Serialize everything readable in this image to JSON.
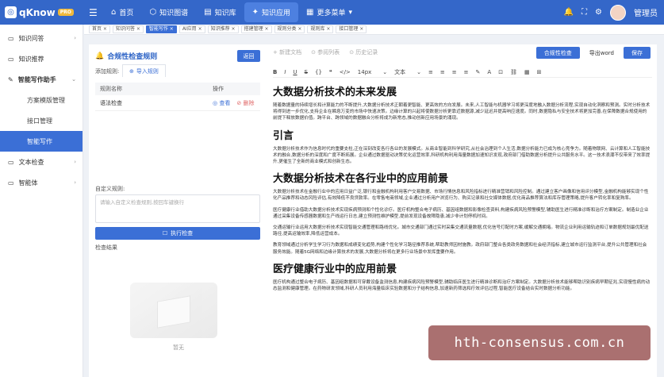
{
  "app": {
    "logo": "qKnow",
    "badge": "PRO",
    "logo_mark": "◎"
  },
  "topnav": {
    "menu_icon": "menu-icon",
    "items": [
      {
        "label": "首页",
        "icon": "⌂"
      },
      {
        "label": "知识图谱",
        "icon": "⬡"
      },
      {
        "label": "知识库",
        "icon": "▤"
      },
      {
        "label": "知识应用",
        "icon": "✦"
      },
      {
        "label": "更多菜单",
        "icon": "▦",
        "arrow": "▾"
      }
    ],
    "user": "管理员"
  },
  "sidebar": {
    "items": [
      {
        "label": "知识问答",
        "icon": "▭",
        "arrow": "›"
      },
      {
        "label": "知识推荐",
        "icon": "▭",
        "arrow": ""
      },
      {
        "label": "智能写作助手",
        "icon": "✎",
        "arrow": "⌄"
      },
      {
        "label": "文本检查",
        "icon": "▭",
        "arrow": "›"
      },
      {
        "label": "智能体",
        "icon": "▭",
        "arrow": "›"
      }
    ],
    "subitems": [
      "方案模版管理",
      "接口管理",
      "智能写作"
    ]
  },
  "tabs": [
    "首页 ×",
    "知识问答 ×",
    "智能写作 ×",
    "AI应用 ×",
    "知识推荐 ×",
    "搭建管理 ×",
    "规则分类 ×",
    "规则库 ×",
    "接口管理 ×"
  ],
  "left_panel": {
    "title": "合规性检查规则",
    "title_icon": "🔔",
    "back": "返回",
    "add_label": "添加规则:",
    "import_tab": "导入规则",
    "import_icon": "⊕",
    "table_head": [
      "规则名称",
      "操作"
    ],
    "rows": [
      {
        "name": "语法检查",
        "view": "查看",
        "del": "删除",
        "view_icon": "◎",
        "del_icon": "⊘"
      }
    ],
    "custom_label": "自定义规则:",
    "custom_placeholder": "请输入自定义检查规则,按回车键换行",
    "exec": "执行检查",
    "exec_icon": "☐",
    "result_label": "检查结果",
    "empty": "暂无"
  },
  "editor": {
    "tb1": [
      "+ 新建文档",
      "⊙ 参阅列表",
      "⊙ 历史记录"
    ],
    "check_btn": "合规性检查",
    "export_btn": "导出word",
    "save_btn": "保存",
    "tb2_icons": [
      "B",
      "I",
      "U",
      "S",
      "{}",
      "❝",
      "</>"
    ],
    "font_size": "14px",
    "font_size_arrow": "⌄",
    "text_style": "文本",
    "text_style_arrow": "⌄",
    "tb2_tail": [
      "≡",
      "≡",
      "≡",
      "≡",
      "✎",
      "A",
      "⊡",
      "⛓",
      "▦",
      "⊞"
    ],
    "doc": {
      "h1": "大数据分析技术的未来发展",
      "p1": "随着数据量的持续增长和计算能力的不断提升,大数据分析技术正朝着更智能、更高效的方向发展。未来,人工智能与机器学习将更深度地融入数据分析流程,实现自动化洞察和预测。实时分析技术将得到进一步优化,支持企业在瞬息万变的市场中快速决策。边缘计算的兴起将使数据分析更靠近数据源,减少延迟并提高响应速度。同时,数据隐私与安全技术将更加完善,在保障数据合规使用的前提下释放数据价值。跨平台、跨领域的数据融合分析将成为新常态,推动创新应用场景的涌现。",
      "h2": "引言",
      "p2": "大数据分析技术作为信息时代的重要支柱,正在深刻改变各行各业的发展模式。从商业智能到科学研究,从社会治理到个人生活,数据分析能力已成为核心竞争力。随着物联网、云计算和人工智能技术的融合,数据分析的深度和广度不断拓展。企业通过数据驱动决策优化运营效率,科研机构利用海量数据加速知识发现,政府部门借助数据分析提升公共服务水平。这一技术浪潮不仅带来了效率提升,更催生了全新的商业模式和创新生态。",
      "h3": "大数据分析技术在各行业中的应用前景",
      "p3": "大数据分析技术在金融行业中的应用日益广泛,银行和金融机构利用客户交易数据、市场行情信息和风险指标进行精准营销和风险控制。通过建立客户画像和信用评分模型,金融机构能够实现个性化产品推荐和动态风险评估,有效降低不良贷款率。在零售电商领域,企业通过分析用户浏览行为、购买记录和社交媒体数据,优化商品推荐算法和库存管理策略,提升客户转化率和复购率。",
      "p4": "医疗健康行业借助大数据分析技术实现疾病预测和个性化诊疗。医疗机构整合电子病历、基因组数据和影像检查资料,构建疾病风险预警模型,辅助医生进行精准诊断和治疗方案制定。制造业企业通过采集设备传感器数据和生产线运行日志,建立预测性维护模型,提前发现设备故障隐患,减少非计划停机时间。",
      "p5": "交通运输行业运用大数据分析技术实现智能交通管理和路线优化。城市交通部门通过实时采集交通流量数据,优化信号灯配时方案,缓解交通拥堵。物流企业利用运输轨迹和订单数据规划最优配送路径,提高运输效率,降低运营成本。",
      "p6": "教育领域通过分析学生学习行为数据和成绩变化趋势,构建个性化学习路径推荐系统,帮助教师因材施教。政府部门整合各类政务数据和社会经济指标,建立城市运行监测平台,提升公共管理和社会服务效能。随着5G网络和边缘计算技术的发展,大数据分析将在更多行业场景中发挥重要作用。",
      "h4": "医疗健康行业中的应用前景",
      "p7": "医疗机构通过整合电子病历、基因组数据和可穿戴设备监测信息,构建疾病风险预警模型,辅助临床医生进行精准诊断和治疗方案制定。大数据分析技术能够帮助识别疾病早期征兆,实现慢性病的动态监测和健康管理。在药物研发领域,科研人员利用海量临床实验数据和分子结构信息,加速新药筛选和疗效评估过程,智能医疗设备结合实时数据分析功能。"
    }
  },
  "watermark": "hth-consensus.com.cn"
}
